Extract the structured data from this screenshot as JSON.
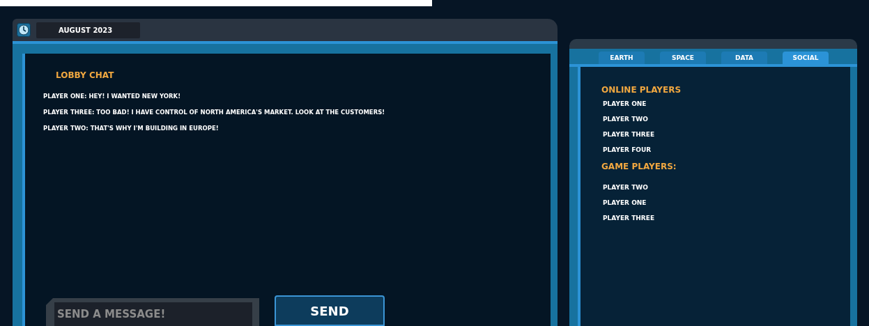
{
  "header": {
    "date": "AUGUST 2023"
  },
  "chat": {
    "title": "LOBBY CHAT",
    "messages": [
      "PLAYER ONE: HEY! I WANTED NEW YORK!",
      "PLAYER THREE: TOO BAD! I HAVE CONTROL OF NORTH AMERICA'S MARKET. LOOK AT THE CUSTOMERS!",
      "PLAYER TWO: THAT'S WHY I'M BUILDING IN EUROPE!"
    ],
    "input": {
      "placeholder": "SEND A MESSAGE!"
    },
    "send_button": "SEND"
  },
  "tabs": [
    {
      "label": "EARTH",
      "selected": false
    },
    {
      "label": "SPACE",
      "selected": false
    },
    {
      "label": "DATA",
      "selected": false
    },
    {
      "label": "SOCIAL",
      "selected": true
    }
  ],
  "sections": [
    {
      "title": "ONLINE PLAYERS",
      "players": [
        "PLAYER ONE",
        "PLAYER TWO",
        "PLAYER THREE",
        "PLAYER FOUR"
      ]
    },
    {
      "title": "GAME PLAYERS:",
      "players": [
        "PLAYER TWO",
        "PLAYER ONE",
        "PLAYER THREE"
      ]
    }
  ]
}
